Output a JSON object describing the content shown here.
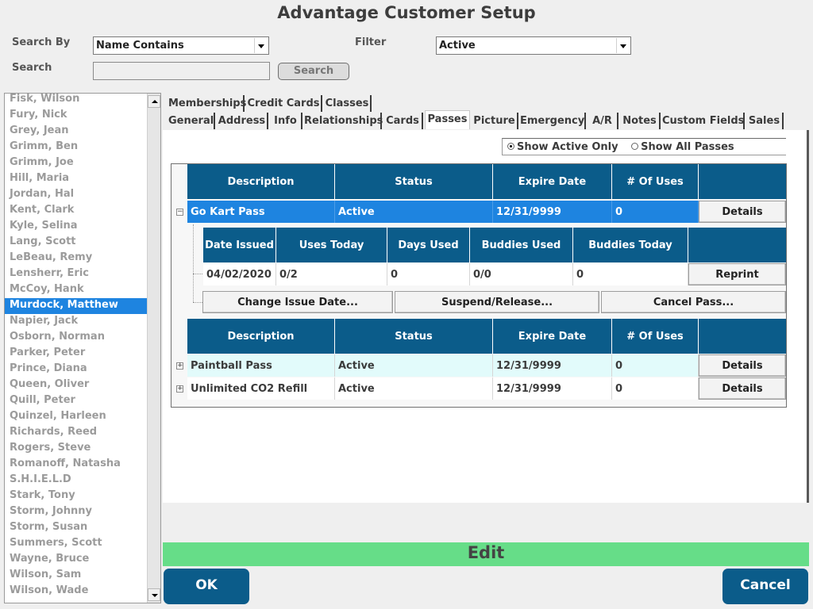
{
  "window": {
    "title": "Advantage Customer Setup"
  },
  "search": {
    "search_by_label": "Search By",
    "search_by_value": "Name Contains",
    "filter_label": "Filter",
    "filter_value": "Active",
    "search_label": "Search",
    "search_input_value": "",
    "search_button_label": "Search"
  },
  "customers": [
    "Fisk, Wilson",
    "Fury, Nick",
    "Grey, Jean",
    "Grimm, Ben",
    "Grimm, Joe",
    "Hill, Maria",
    "Jordan, Hal",
    "Kent, Clark",
    "Kyle, Selina",
    "Lang, Scott",
    "LeBeau, Remy",
    "Lensherr, Eric",
    "McCoy, Hank",
    "Murdock, Matthew",
    "Napier, Jack",
    "Osborn, Norman",
    "Parker, Peter",
    "Prince, Diana",
    "Queen, Oliver",
    "Quill, Peter",
    "Quinzel, Harleen",
    "Richards, Reed",
    "Rogers, Steve",
    "Romanoff, Natasha",
    "S.H.I.E.L.D",
    "Stark, Tony",
    "Storm, Johnny",
    "Storm, Susan",
    "Summers, Scott",
    "Wayne, Bruce",
    "Wilson, Sam",
    "Wilson, Wade"
  ],
  "selected_customer": "Murdock, Matthew",
  "tabs_top": [
    "Memberships",
    "Credit Cards",
    "Classes"
  ],
  "tabs_bottom": [
    "General",
    "Address",
    "Info",
    "Relationships",
    "Cards",
    "Passes",
    "Picture",
    "Emergency",
    "A/R",
    "Notes",
    "Custom Fields",
    "Sales"
  ],
  "active_tab": "Passes",
  "pass_filter": {
    "active_only_label": "Show Active Only",
    "all_label": "Show All Passes",
    "selected": "active_only"
  },
  "pass_columns": [
    "Description",
    "Status",
    "Expire Date",
    "# Of Uses"
  ],
  "detail_columns": [
    "Date Issued",
    "Uses Today",
    "Days Used",
    "Buddies Used",
    "Buddies Today"
  ],
  "expanded_pass": {
    "description": "Go Kart Pass",
    "status": "Active",
    "expire": "12/31/9999",
    "uses": "0",
    "details_label": "Details",
    "detail_row": {
      "date_issued": "04/02/2020",
      "uses_today": "0/2",
      "days_used": "0",
      "buddies_used": "0/0",
      "buddies_today": "0"
    },
    "reprint_label": "Reprint",
    "actions": {
      "change_issue_date": "Change Issue Date...",
      "suspend_release": "Suspend/Release...",
      "cancel_pass": "Cancel Pass..."
    }
  },
  "other_passes": [
    {
      "description": "Paintball Pass",
      "status": "Active",
      "expire": "12/31/9999",
      "uses": "0",
      "details_label": "Details"
    },
    {
      "description": "Unlimited CO2 Refill",
      "status": "Active",
      "expire": "12/31/9999",
      "uses": "0",
      "details_label": "Details"
    }
  ],
  "mode_label": "Edit",
  "buttons": {
    "ok": "OK",
    "cancel": "Cancel"
  },
  "colors": {
    "header_blue": "#0b5c8a",
    "selection_blue": "#1e84e0",
    "edit_green": "#66dd88"
  }
}
